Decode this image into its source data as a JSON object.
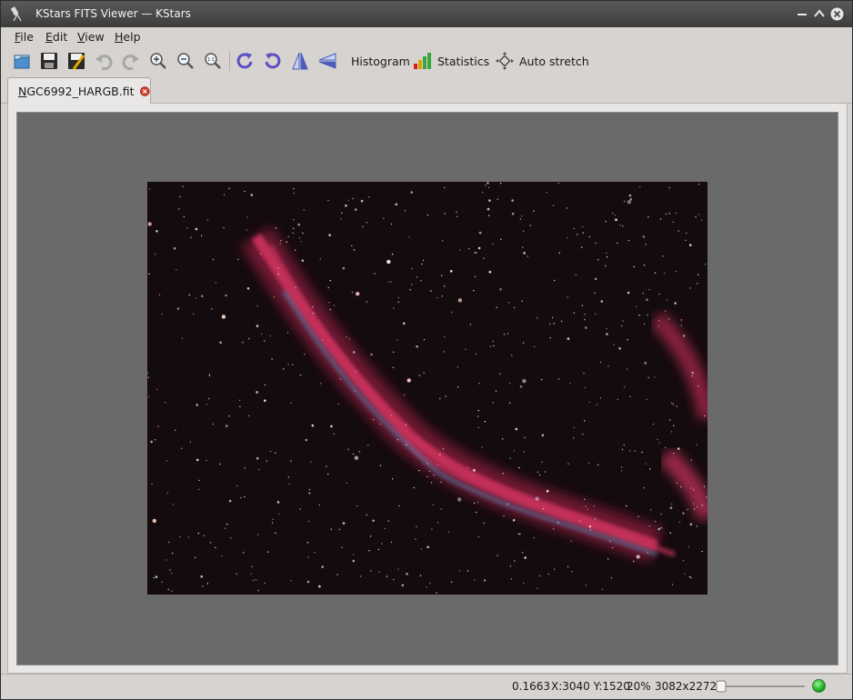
{
  "window": {
    "title": "KStars FITS Viewer — KStars",
    "accent_color": "#3c3c3c"
  },
  "menu": {
    "items": [
      {
        "label": "File"
      },
      {
        "label": "Edit"
      },
      {
        "label": "View"
      },
      {
        "label": "Help"
      }
    ]
  },
  "toolbar": {
    "icons": [
      "open-icon",
      "save-icon",
      "save-as-icon",
      "undo-icon",
      "redo-icon",
      "zoom-in-icon",
      "zoom-out-icon",
      "zoom-default-icon",
      "rotate-right-icon",
      "rotate-left-icon",
      "flip-vertical-icon",
      "flip-horizontal-icon",
      "histogram-bars-icon",
      "auto-stretch-icon"
    ],
    "histogram_label": "Histogram",
    "statistics_label": "Statistics",
    "auto_stretch_label": "Auto stretch"
  },
  "tabs": [
    {
      "label": "NGC6992_HARGB.fit",
      "active": true
    }
  ],
  "viewer": {
    "background_color": "#6a6a6a",
    "image_description_colors": [
      "#140b0e",
      "#c8305a",
      "#6fa0c8"
    ]
  },
  "status": {
    "pixel_value": "0.1663",
    "coordinates": "X:3040 Y:1520",
    "zoom": "20%",
    "resolution": "3082x2272",
    "zoom_slider_value": 0,
    "led_color": "#21b321"
  }
}
